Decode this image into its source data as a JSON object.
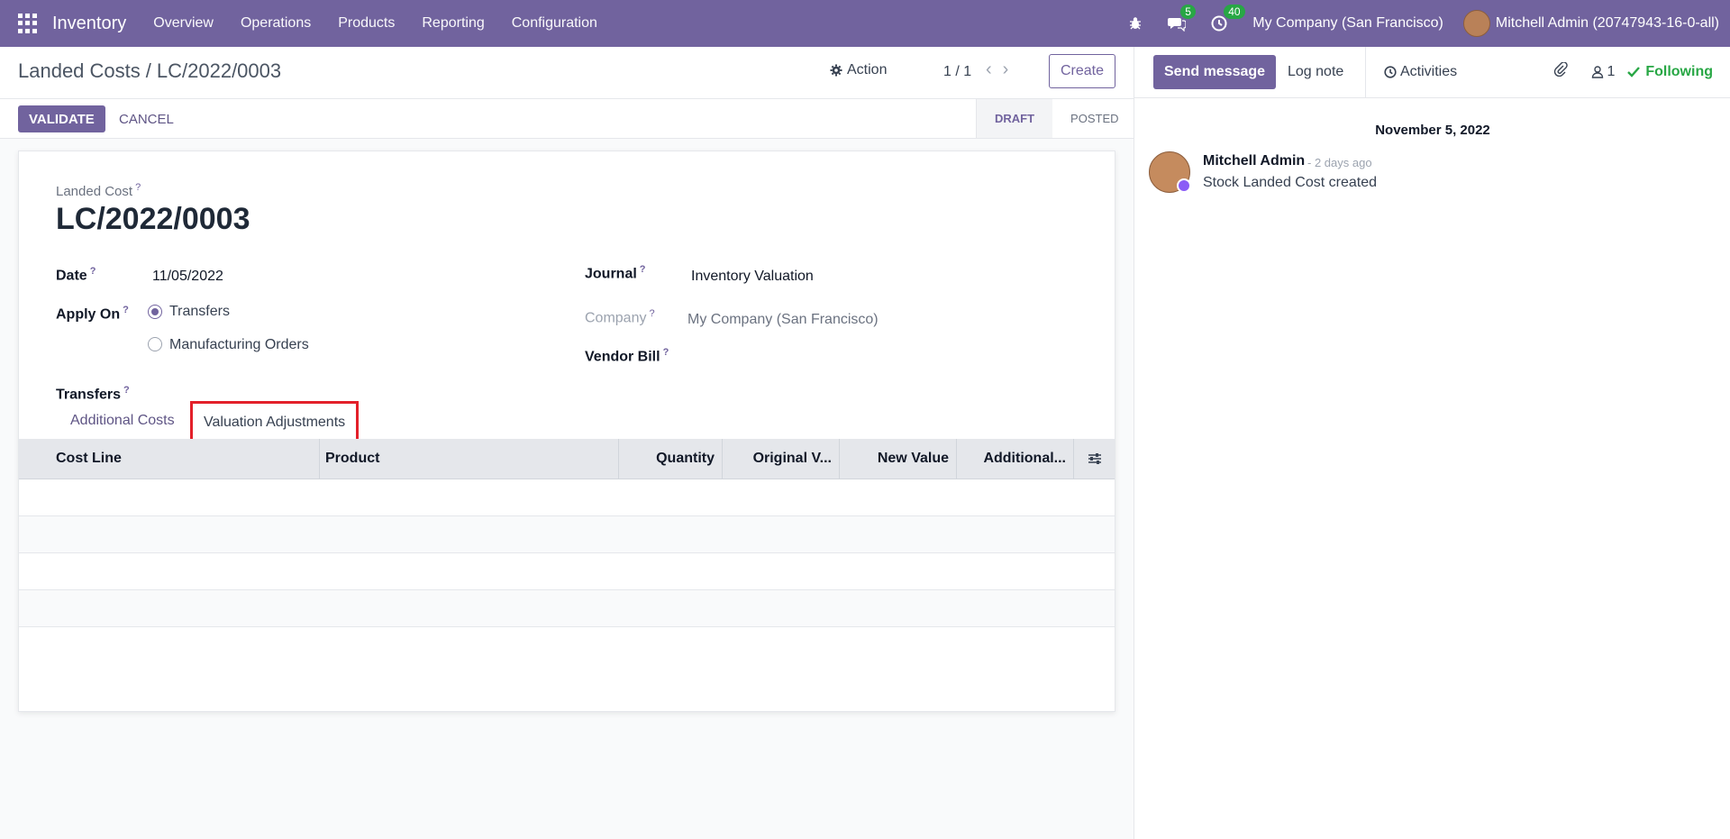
{
  "navbar": {
    "app_name": "Inventory",
    "menu": [
      "Overview",
      "Operations",
      "Products",
      "Reporting",
      "Configuration"
    ],
    "messages_count": "5",
    "activities_count": "40",
    "company": "My Company (San Francisco)",
    "user": "Mitchell Admin (20747943-16-0-all)"
  },
  "breadcrumb": {
    "parent": "Landed Costs",
    "separator": "/",
    "current": "LC/2022/0003"
  },
  "toolbar": {
    "action_label": "Action",
    "pager": "1 / 1",
    "create_label": "Create"
  },
  "statusbar": {
    "validate_label": "VALIDATE",
    "cancel_label": "CANCEL",
    "stages": [
      "DRAFT",
      "POSTED"
    ],
    "active_stage": "DRAFT"
  },
  "form": {
    "record_label": "Landed Cost",
    "record_name": "LC/2022/0003",
    "date_label": "Date",
    "date_value": "11/05/2022",
    "apply_on_label": "Apply On",
    "apply_on_options": [
      "Transfers",
      "Manufacturing Orders"
    ],
    "apply_on_selected": "Transfers",
    "transfers_label": "Transfers",
    "journal_label": "Journal",
    "journal_value": "Inventory Valuation",
    "company_label": "Company",
    "company_value": "My Company (San Francisco)",
    "vendor_bill_label": "Vendor Bill",
    "help_mark": "?"
  },
  "tabs": {
    "items": [
      "Additional Costs",
      "Valuation Adjustments"
    ],
    "active": "Valuation Adjustments"
  },
  "grid": {
    "columns": [
      "Cost Line",
      "Product",
      "Quantity",
      "Original V...",
      "New Value",
      "Additional..."
    ],
    "rows": []
  },
  "chatter": {
    "send_message_label": "Send message",
    "log_note_label": "Log note",
    "activities_label": "Activities",
    "followers_count": "1",
    "following_label": "Following",
    "date_separator": "November 5, 2022",
    "message": {
      "author": "Mitchell Admin",
      "time": "- 2 days ago",
      "body": "Stock Landed Cost created"
    }
  },
  "colors": {
    "brand": "#71639e",
    "highlight": "#e3202a",
    "success": "#28a745"
  }
}
